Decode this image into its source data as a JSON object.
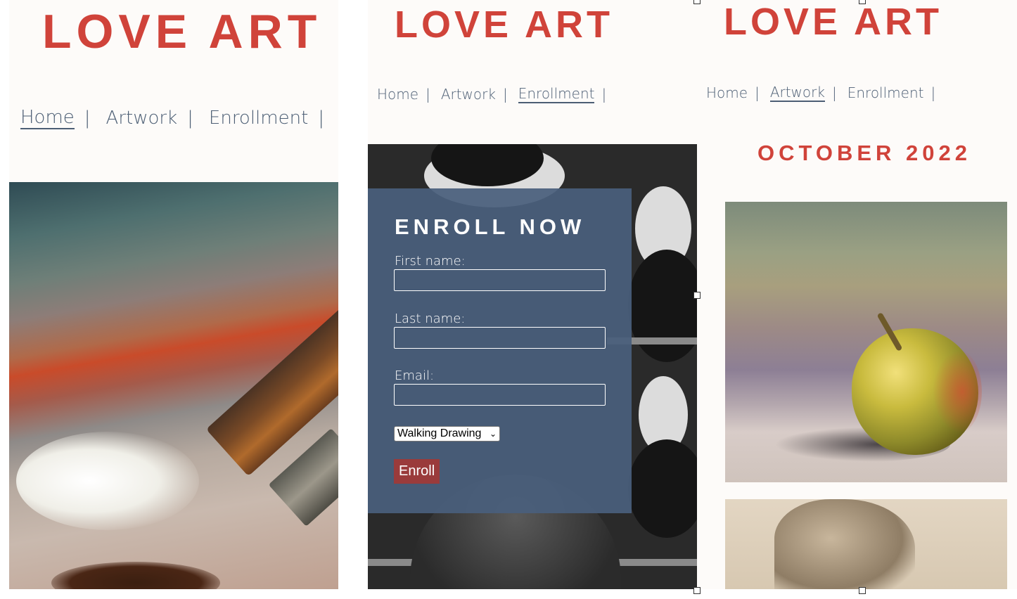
{
  "brand": {
    "logo": "LOVE ART",
    "accent_color": "#d0433a",
    "nav_color": "#4c5e74"
  },
  "nav": {
    "items": [
      {
        "label": "Home"
      },
      {
        "label": "Artwork"
      },
      {
        "label": "Enrollment"
      }
    ],
    "separator": "|"
  },
  "panels": [
    {
      "active_nav": "Home",
      "hero": "paintbrush-with-oil-paint"
    },
    {
      "active_nav": "Enrollment"
    },
    {
      "active_nav": "Artwork"
    }
  ],
  "enroll": {
    "title": "ENROLL NOW",
    "first_name_label": "First name:",
    "last_name_label": "Last name:",
    "email_label": "Email:",
    "first_name_value": "",
    "last_name_value": "",
    "email_value": "",
    "course_selected": "Walking Drawing",
    "submit_label": "Enroll",
    "panel_color": "#495f7c",
    "button_color": "#9a3b3b"
  },
  "artwork": {
    "month_heading": "OCTOBER 2022",
    "pieces": [
      {
        "subject": "apple-still-life-painting"
      },
      {
        "subject": "torso-figure-drawing"
      }
    ]
  }
}
